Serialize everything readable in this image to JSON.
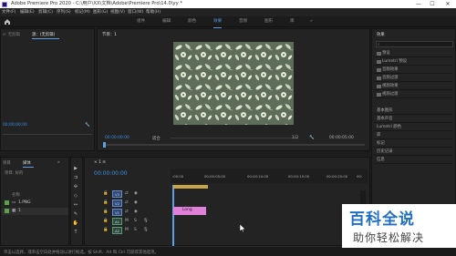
{
  "window": {
    "title": "Adobe Premiere Pro 2020 - C:\\用户\\XX\\文档\\Adobe\\Premiere Pro\\14.0\\yy *",
    "minimize": "—",
    "maximize": "☐",
    "close": "✕"
  },
  "menu": [
    "文件(F)",
    "编辑(E)",
    "剪辑(C)",
    "序列(S)",
    "标记(M)",
    "图形(G)",
    "视图(V)",
    "窗口(W)",
    "帮助(H)"
  ],
  "workspaces": {
    "home_icon": "home-icon",
    "tabs": [
      "组件",
      "编辑",
      "颜色",
      "效果",
      "音频",
      "图形",
      "库"
    ],
    "active": "效果",
    "overflow": "»"
  },
  "source_panel": {
    "tab_truncated": "e: 无剪辑",
    "tab_active": "源：(无剪辑)",
    "timecode": "00;00;00;00",
    "settings_icon": "wrench-icon"
  },
  "program_panel": {
    "title": "节目：1",
    "timecode_left": "00:00:00:00",
    "fit": "适合",
    "fraction": "1/2",
    "timecode_right": "00:00:05:00",
    "settings_icon": "wrench-icon"
  },
  "effects_panel": {
    "title": "效果",
    "search_placeholder": "",
    "items": [
      "预设",
      "Lumetri 预设",
      "音频效果",
      "音频过渡",
      "视频效果",
      "视频过渡"
    ],
    "lower_sections": [
      "基本图形",
      "基本声音",
      "Lumetri 颜色",
      "库",
      "标记",
      "历史记录",
      "信息"
    ]
  },
  "project_panel": {
    "tab_inactive": "项目",
    "tab_active": "媒体",
    "tab_more": "»",
    "breadcrumb": "项目: 好的",
    "header_name": "名称",
    "files": [
      {
        "name": "1.PNG",
        "color": "#5aa04a"
      },
      {
        "name": "1",
        "color": "#5aa04a"
      }
    ]
  },
  "tools": [
    "▶",
    "⇉",
    "✣",
    "◇",
    "↔",
    "✎",
    "✋",
    "T"
  ],
  "timeline": {
    "title": "× 1 ≡",
    "timecode": "00:00:00:00",
    "ruler": [
      ":00:00",
      "00:00:05:00",
      "00:00:10:00",
      "00:00:15:00",
      "00:00:20:00",
      "00:"
    ],
    "tracks": [
      {
        "label": "V3",
        "icons": [
          "lock-icon",
          "sync-icon",
          "eye-icon"
        ]
      },
      {
        "label": "V2",
        "icons": [
          "lock-icon",
          "sync-icon",
          "eye-icon"
        ]
      },
      {
        "label": "V1",
        "icons": [
          "lock-icon",
          "sync-icon",
          "eye-icon"
        ]
      },
      {
        "label": "A1",
        "icons": [
          "lock-icon",
          "M",
          "S"
        ]
      },
      {
        "label": "A2",
        "icons": [
          "lock-icon",
          "M",
          "S"
        ]
      },
      {
        "label": "A3",
        "icons": [
          "lock-icon",
          "M",
          "S"
        ]
      }
    ],
    "clip_label": "Long"
  },
  "status": {
    "text": "单击以选择，或单击空白处并拖动以进行框选。按 Shift、Alt 和 Ctrl 可获得其他选项。"
  },
  "watermark": {
    "top": "百科全说",
    "bottom": "助你轻松解决"
  },
  "colors": {
    "accent": "#5da2e8",
    "timecode": "#3d8fe0",
    "clip_pink": "#e080d8",
    "clip_yellow": "#c8a44a",
    "watermark_blue": "#1f6fc4"
  }
}
